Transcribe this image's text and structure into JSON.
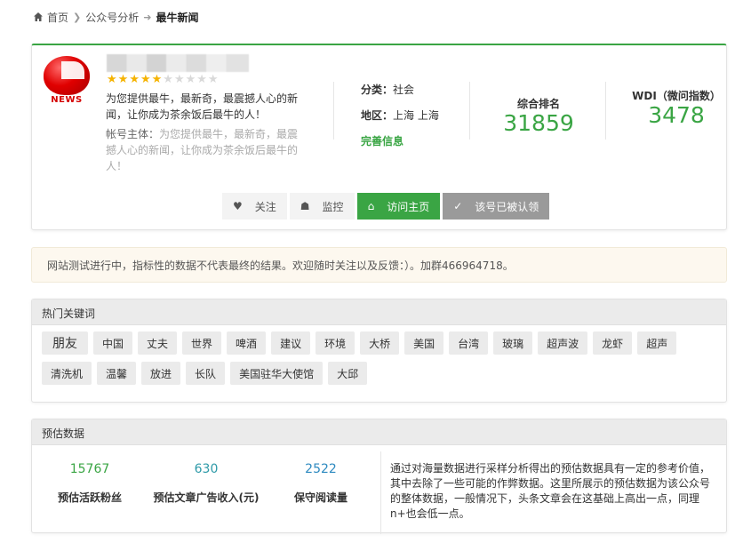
{
  "breadcrumb": {
    "home": "首页",
    "section": "公众号分析",
    "current": "最牛新闻"
  },
  "profile": {
    "logo_text": "NEWS",
    "rating": {
      "filled": 5,
      "total": 10
    },
    "description": "为您提供最牛，最新奇，最震撼人心的新闻，让你成为茶余饭后最牛的人！",
    "owner_label": "帐号主体：",
    "owner_value": "为您提供最牛，最新奇，最震撼人心的新闻，让你成为茶余饭后最牛的人！",
    "category_label": "分类：",
    "category_value": "社会",
    "region_label": "地区：",
    "region_value": "上海 上海",
    "complete_link": "完善信息",
    "rank_label": "综合排名",
    "rank_value": "31859",
    "wdi_label": "WDI（微问指数）",
    "wdi_value": "3478"
  },
  "actions": {
    "follow": "关注",
    "monitor": "监控",
    "visit": "访问主页",
    "claimed": "该号已被认领"
  },
  "notice": "网站测试进行中，指标性的数据不代表最终的结果。欢迎随时关注以及反馈：）。加群466964718。",
  "keywords_panel": {
    "title": "热门关键词",
    "keywords": [
      "朋友",
      "中国",
      "丈夫",
      "世界",
      "啤酒",
      "建议",
      "环境",
      "大桥",
      "美国",
      "台湾",
      "玻璃",
      "超声波",
      "龙虾",
      "超声",
      "清洗机",
      "温馨",
      "放进",
      "长队",
      "美国驻华大使馆",
      "大邱"
    ]
  },
  "estimate_panel": {
    "title": "预估数据",
    "items": [
      {
        "value": "15767",
        "label": "预估活跃粉丝",
        "color": "#3aa544"
      },
      {
        "value": "630",
        "label": "预估文章广告收入(元)",
        "color": "#2e9aa8"
      },
      {
        "value": "2522",
        "label": "保守阅读量",
        "color": "#2e8ac0"
      }
    ],
    "description": "通过对海量数据进行采样分析得出的预估数据具有一定的参考价值，其中去除了一些可能的作弊数据。这里所展示的预估数据为该公众号的整体数据，一般情况下，头条文章会在这基础上高出一点，同理n+也会低一点。"
  },
  "colors": {
    "accent": "#3aa544",
    "claimed_button": "#9a9a9a"
  }
}
